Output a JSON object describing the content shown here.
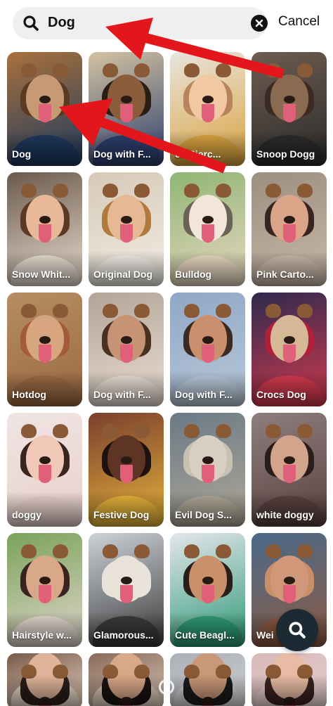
{
  "search": {
    "query": "Dog",
    "cancel_label": "Cancel"
  },
  "lenses": [
    {
      "label": "Dog"
    },
    {
      "label": "Dog with F..."
    },
    {
      "label": "ck Pierc..."
    },
    {
      "label": "Snoop Dogg"
    },
    {
      "label": "Snow Whit..."
    },
    {
      "label": "Original Dog"
    },
    {
      "label": "Bulldog"
    },
    {
      "label": "Pink Carto..."
    },
    {
      "label": "Hotdog"
    },
    {
      "label": "Dog with F..."
    },
    {
      "label": "Dog with F..."
    },
    {
      "label": "Crocs Dog"
    },
    {
      "label": "doggy"
    },
    {
      "label": "Festive Dog"
    },
    {
      "label": "Evil Dog S..."
    },
    {
      "label": "white doggy"
    },
    {
      "label": "Hairstyle w..."
    },
    {
      "label": "Glamorous..."
    },
    {
      "label": "Cute Beagl..."
    },
    {
      "label": "Wei"
    },
    {
      "label": ""
    },
    {
      "label": ""
    },
    {
      "label": ""
    },
    {
      "label": ""
    }
  ],
  "icons": {
    "search": "search-icon",
    "clear": "close-icon",
    "fab": "search-icon"
  },
  "colors": {
    "annotation_arrow": "#e3161b",
    "fab_bg": "#1c2a33"
  }
}
